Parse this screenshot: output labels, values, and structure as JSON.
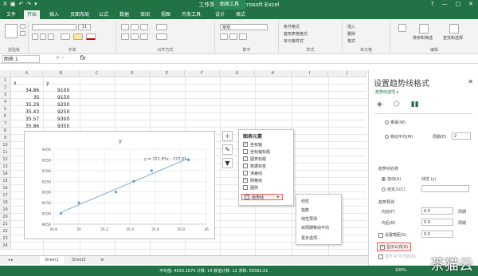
{
  "titlebar": {
    "title": "工作簿1.xlsx - Microsoft Excel",
    "chart_tools": "图表工具",
    "quick_access": [
      "▣",
      "↶",
      "↷",
      "▾"
    ],
    "window_buttons": [
      "?",
      "—",
      "□",
      "✕"
    ]
  },
  "tabs": [
    "文件",
    "开始",
    "插入",
    "页面布局",
    "公式",
    "数据",
    "审阅",
    "视图",
    "开发工具",
    "设计",
    "格式"
  ],
  "ribbon": {
    "groups": [
      "剪贴板",
      "字体",
      "对齐方式",
      "数字",
      "样式",
      "单元格",
      "编辑"
    ],
    "items": {
      "font_size": "11",
      "general": "常规",
      "conditional_format": "条件格式",
      "table_format": "套用表格格式",
      "cell_styles": "单元格样式",
      "insert": "插入",
      "delete": "删除",
      "format": "格式",
      "sort_filter": "排序和筛选",
      "find_select": "查找和选择"
    }
  },
  "formula_bar": {
    "name_box": "图表 1",
    "fx": "fx",
    "cancel": "✕ ✓"
  },
  "columns": [
    "A",
    "B",
    "C",
    "D",
    "E",
    "F",
    "G",
    "H",
    "I",
    "J"
  ],
  "rows": [
    "1",
    "2",
    "3",
    "4",
    "5",
    "6",
    "7",
    "8",
    "9",
    "10",
    "11",
    "12",
    "13",
    "14",
    "15",
    "16",
    "17",
    "18",
    "19",
    "20",
    "21",
    "22",
    "23",
    "24"
  ],
  "cells": {
    "a1": "x",
    "b1": "y",
    "a2": "34.86",
    "b2": "9100",
    "a3": "35",
    "b3": "9150",
    "a4": "35.29",
    "b4": "9200",
    "a5": "35.43",
    "b5": "9250",
    "a6": "35.57",
    "b6": "9300",
    "a7": "35.86",
    "b7": "9350"
  },
  "chart_data": {
    "type": "scatter",
    "title": "y",
    "x": [
      34.86,
      35,
      35.29,
      35.43,
      35.57,
      35.86
    ],
    "y": [
      9100,
      9150,
      9200,
      9250,
      9300,
      9350
    ],
    "xlim": [
      34.8,
      36
    ],
    "ylim": [
      9050,
      9400
    ],
    "x_ticks": [
      "34.8",
      "35",
      "35.2",
      "35.4",
      "35.6",
      "35.8",
      "36"
    ],
    "y_ticks": [
      "9050",
      "9100",
      "9150",
      "9200",
      "9250",
      "9300",
      "9350",
      "9400"
    ],
    "trendline_equation": "y = 251.83x - 223.01",
    "colors": {
      "point": "#5b9bd5",
      "trendline": "#5b9bd5"
    }
  },
  "chart_elements_menu": {
    "header": "图表元素",
    "items": [
      {
        "label": "坐标轴",
        "checked": true
      },
      {
        "label": "坐标轴标题",
        "checked": false
      },
      {
        "label": "图表标题",
        "checked": true
      },
      {
        "label": "数据标签",
        "checked": false
      },
      {
        "label": "误差线",
        "checked": false
      },
      {
        "label": "网格线",
        "checked": true
      },
      {
        "label": "图例",
        "checked": false
      },
      {
        "label": "趋势线",
        "checked": true
      }
    ]
  },
  "trendline_submenu": [
    "线性",
    "指数",
    "线性预测",
    "双周期移动平均",
    "更多选项..."
  ],
  "format_pane": {
    "title": "设置趋势线格式",
    "subtitle": "趋势线选项 ▾",
    "types": [
      "乘幂(W)",
      "移动平均(M)"
    ],
    "period_label": "周期(E)",
    "period_value": "2",
    "name_header": "趋势线名称",
    "auto": "自动(A)",
    "auto_value": "线性 (y)",
    "custom": "自定义(C)",
    "forecast_header": "趋势预测",
    "forward": "向前(F)",
    "forward_value": "0.0",
    "backward": "向后(B)",
    "backward_value": "0.0",
    "unit": "周期",
    "intercept": "设置截距(S)",
    "intercept_value": "0.0",
    "show_equation": "显示公式(E)",
    "show_r2": "显示 R 平方值(R)"
  },
  "sheets": [
    "Sheet1",
    "Sheet2"
  ],
  "status": {
    "text": "平均值: 4630.1675    计数: 14    数值计数: 12    求和: 55562.01",
    "zoom": "100%"
  },
  "watermark": "茶猫云"
}
